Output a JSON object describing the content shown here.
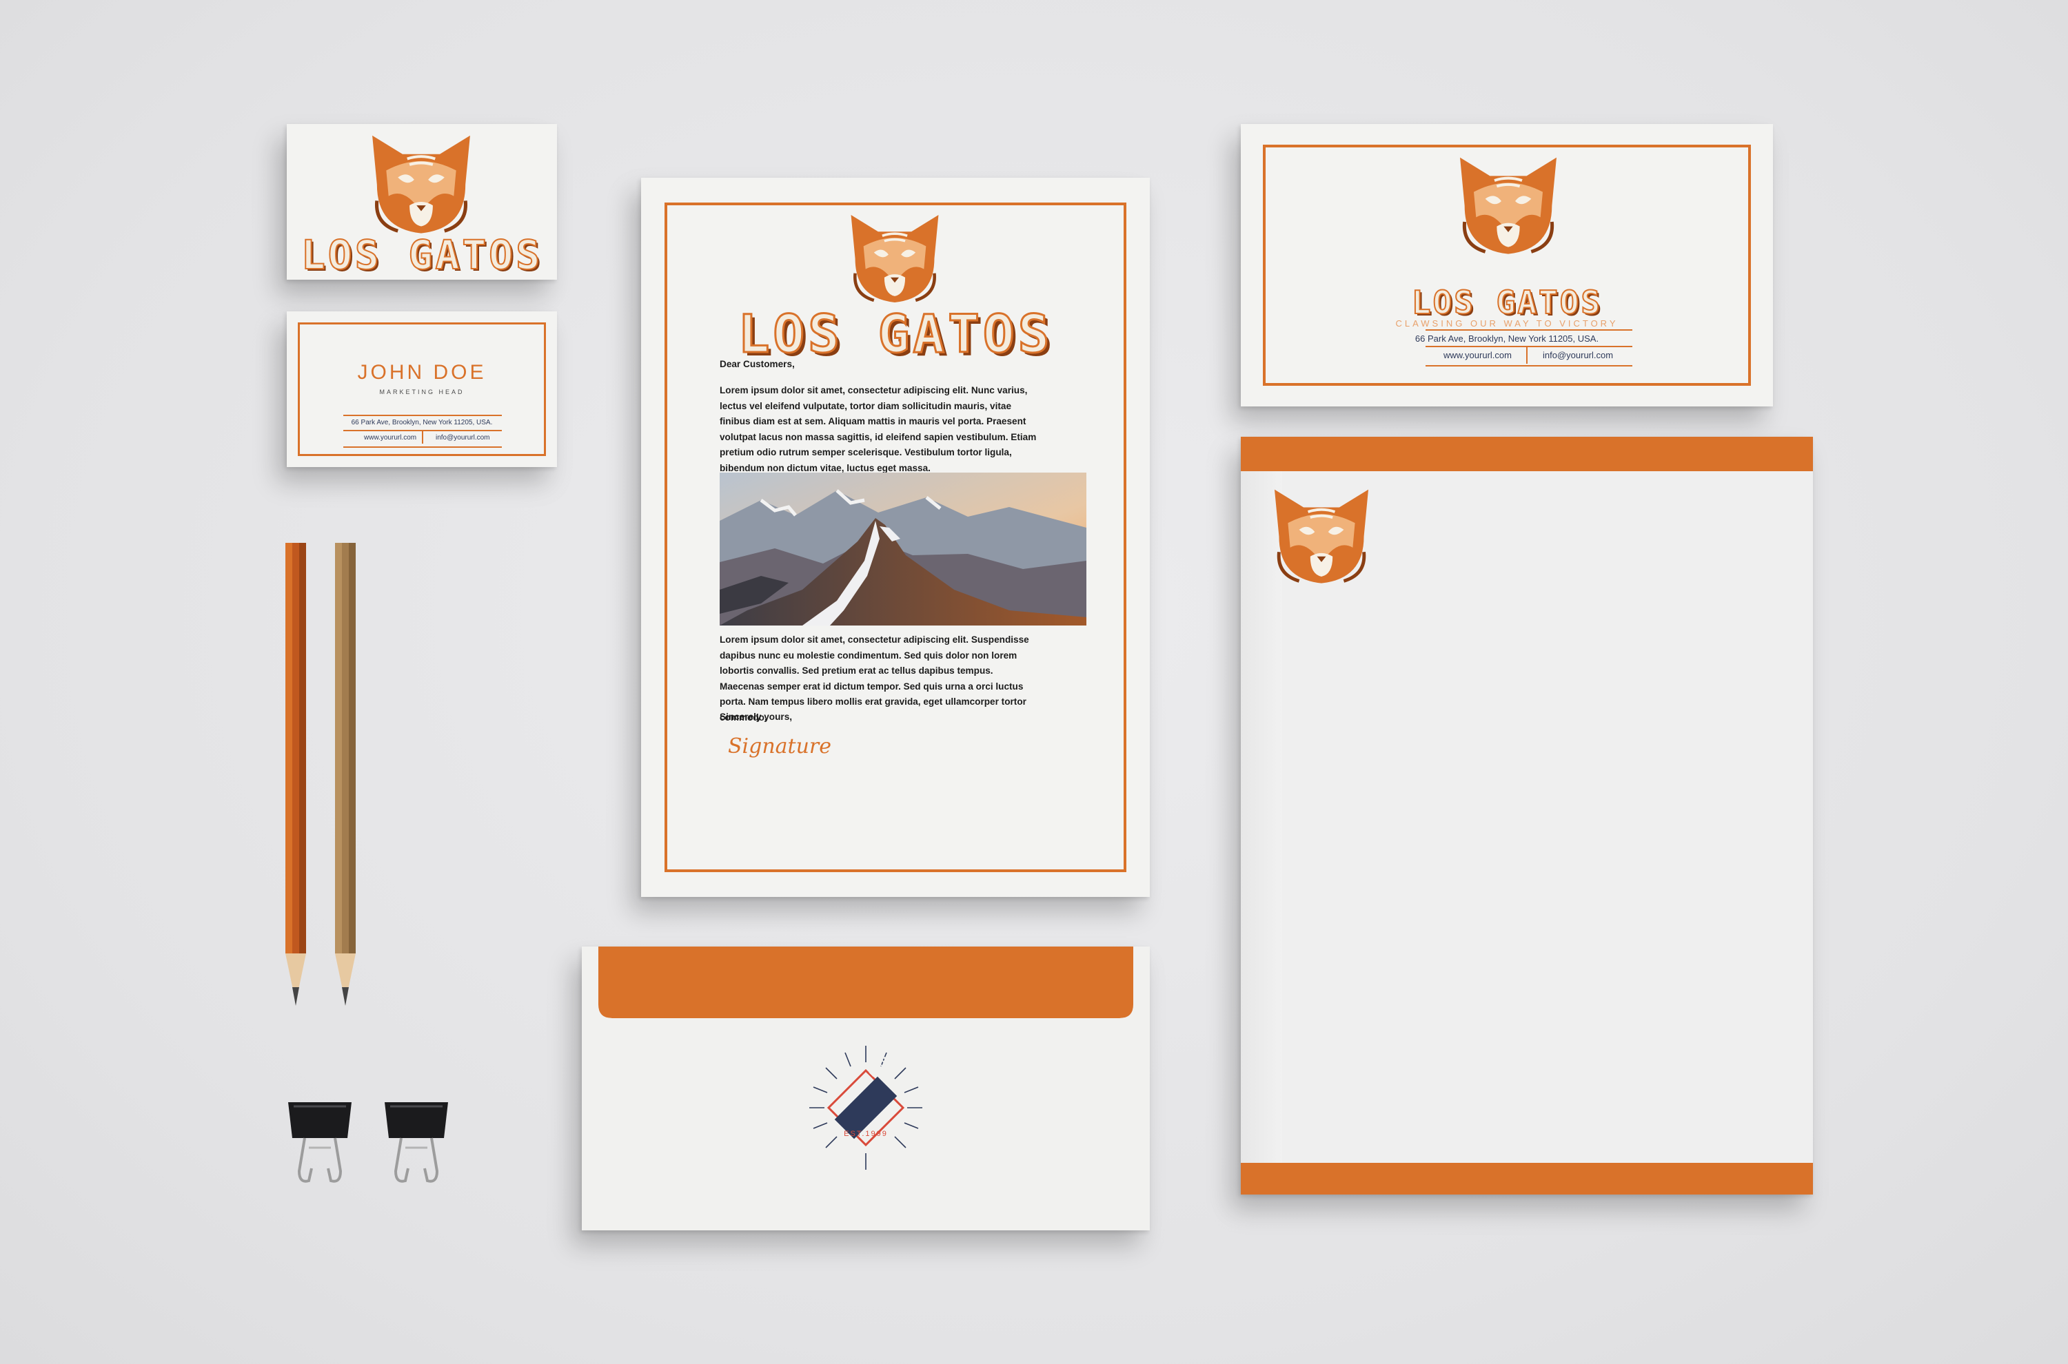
{
  "brand": {
    "name": "LOS GATOS",
    "tagline": "CLAWSING OUR WAY TO VICTORY",
    "accent_color": "#d9722a",
    "text_color": "#2e3a5a"
  },
  "business_card": {
    "name": "JOHN DOE",
    "title": "MARKETING HEAD",
    "address": "66 Park Ave, Brooklyn, New York 11205, USA.",
    "website": "www.yoururl.com",
    "email": "info@yoururl.com"
  },
  "letterhead": {
    "greeting": "Dear Customers,",
    "paragraph_1": "Lorem ipsum dolor sit amet, consectetur adipiscing elit. Nunc varius, lectus vel eleifend vulputate, tortor diam sollicitudin mauris, vitae finibus diam est at sem. Aliquam mattis in mauris vel porta. Praesent volutpat lacus non massa sagittis, id eleifend sapien vestibulum. Etiam pretium odio rutrum semper scelerisque. Vestibulum tortor ligula, bibendum non dictum vitae, luctus eget massa.",
    "paragraph_2": "Lorem ipsum dolor sit amet, consectetur adipiscing elit. Suspendisse dapibus nunc eu molestie condimentum. Sed quis dolor non lorem lobortis convallis. Sed pretium erat ac tellus dapibus tempus. Maecenas semper erat id dictum tempor. Sed quis urna a orci luctus porta. Nam tempus libero mollis erat gravida, eget ullamcorper tortor commodo.",
    "closing": "Sincerely yours,",
    "signature": "Signature"
  },
  "compliment_slip": {
    "address": "66 Park Ave, Brooklyn, New York 11205, USA.",
    "website": "www.yoururl.com",
    "email": "info@yoururl.com"
  },
  "envelope": {
    "badge_text": "LOREM IPSUM",
    "established": "EST.1999"
  },
  "icons": [
    "cat-logo-icon",
    "pencil-icon",
    "binder-clip-icon",
    "mountain-photo"
  ]
}
